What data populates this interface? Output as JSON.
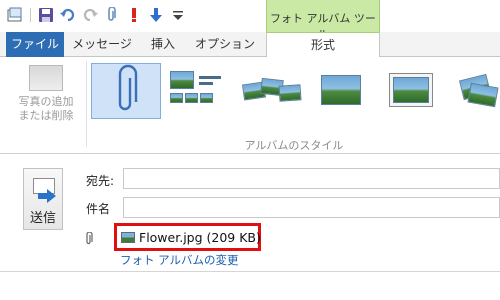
{
  "quick_access": {
    "icons": [
      "app-icon",
      "save-icon",
      "undo-icon",
      "redo-icon",
      "attach-icon",
      "high-priority-icon",
      "low-priority-icon",
      "customize-dropdown-icon"
    ]
  },
  "context_tab_group": {
    "label": "フォト アルバム ツール",
    "color": "#c9e9a4"
  },
  "tabs": [
    {
      "label": "ファイル",
      "active": false
    },
    {
      "label": "メッセージ",
      "active": false
    },
    {
      "label": "挿入",
      "active": false
    },
    {
      "label": "オプション",
      "active": false
    },
    {
      "label": "形式",
      "active": true
    }
  ],
  "ribbon": {
    "add_remove": {
      "label_line1": "写真の追加",
      "label_line2": "または削除",
      "enabled": false
    },
    "album_styles": {
      "group_label": "アルバムのスタイル",
      "styles": [
        {
          "name": "paperclip-style",
          "selected": true
        },
        {
          "name": "grid-with-lines-style",
          "selected": false
        },
        {
          "name": "scattered-photos-style",
          "selected": false
        },
        {
          "name": "single-photo-style",
          "selected": false
        },
        {
          "name": "framed-photo-style",
          "selected": false
        },
        {
          "name": "tilted-stack-style",
          "selected": false
        }
      ]
    }
  },
  "compose": {
    "send_label": "送信",
    "to_label": "宛先:",
    "to_value": "",
    "subject_label": "件名",
    "subject_value": "",
    "attachment": {
      "name": "Flower.jpg (209 KB)",
      "highlight_color": "#e01010"
    },
    "change_album_link": "フォト アルバムの変更"
  },
  "colors": {
    "file_tab": "#2d6db4",
    "link": "#1a5fb4",
    "selected_style": "#cfe2f7"
  }
}
